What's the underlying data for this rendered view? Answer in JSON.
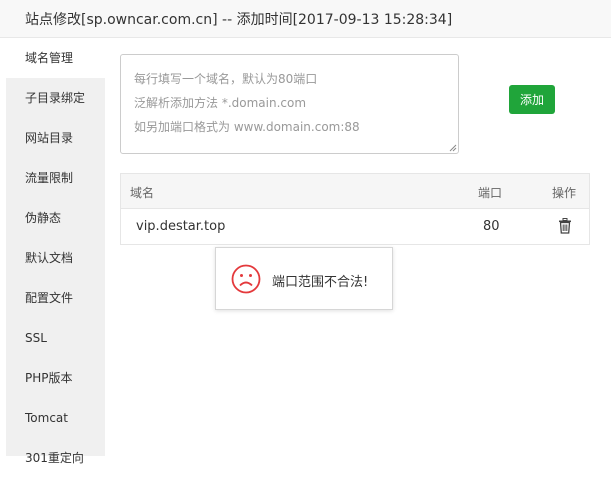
{
  "dialog": {
    "title": "站点修改[sp.owncar.com.cn] -- 添加时间[2017-09-13 15:28:34]"
  },
  "sidebar": {
    "items": [
      {
        "label": "域名管理"
      },
      {
        "label": "子目录绑定"
      },
      {
        "label": "网站目录"
      },
      {
        "label": "流量限制"
      },
      {
        "label": "伪静态"
      },
      {
        "label": "默认文档"
      },
      {
        "label": "配置文件"
      },
      {
        "label": "SSL"
      },
      {
        "label": "PHP版本"
      },
      {
        "label": "Tomcat"
      },
      {
        "label": "301重定向"
      }
    ]
  },
  "domain_input": {
    "placeholder_lines": [
      "每行填写一个域名，默认为80端口",
      "泛解析添加方法 *.domain.com",
      "如另加端口格式为 www.domain.com:88"
    ]
  },
  "add_button": {
    "label": "添加",
    "color": "#20a53a"
  },
  "table": {
    "headers": {
      "domain": "域名",
      "port": "端口",
      "action": "操作"
    },
    "rows": [
      {
        "domain": "vip.destar.top",
        "port": "80"
      }
    ]
  },
  "toast": {
    "message": "端口范围不合法!",
    "icon": "sad-face-icon",
    "icon_color": "#e4393c"
  }
}
